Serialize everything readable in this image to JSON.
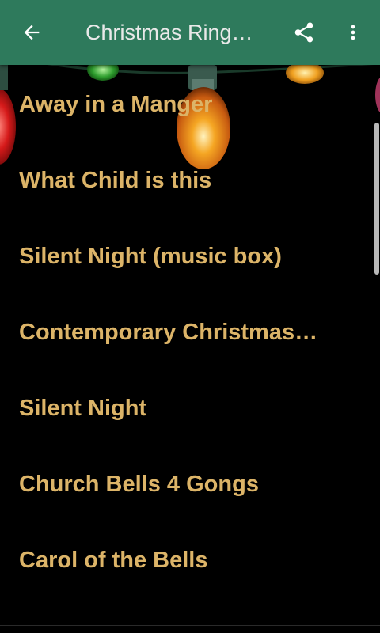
{
  "app_bar": {
    "title": "Christmas Ring…",
    "background_color": "#2e7a5c",
    "back_icon": "arrow-left-icon",
    "share_icon": "share-icon",
    "more_icon": "more-vert-icon"
  },
  "ringtones": [
    {
      "label": "Away in a Manger"
    },
    {
      "label": "What Child is this"
    },
    {
      "label": "Silent Night (music box)"
    },
    {
      "label": "Contemporary Christmas…"
    },
    {
      "label": "Silent Night"
    },
    {
      "label": "Church Bells 4 Gongs"
    },
    {
      "label": "Carol of the Bells"
    }
  ],
  "colors": {
    "item_text": "#dcb468",
    "background": "#000000"
  }
}
